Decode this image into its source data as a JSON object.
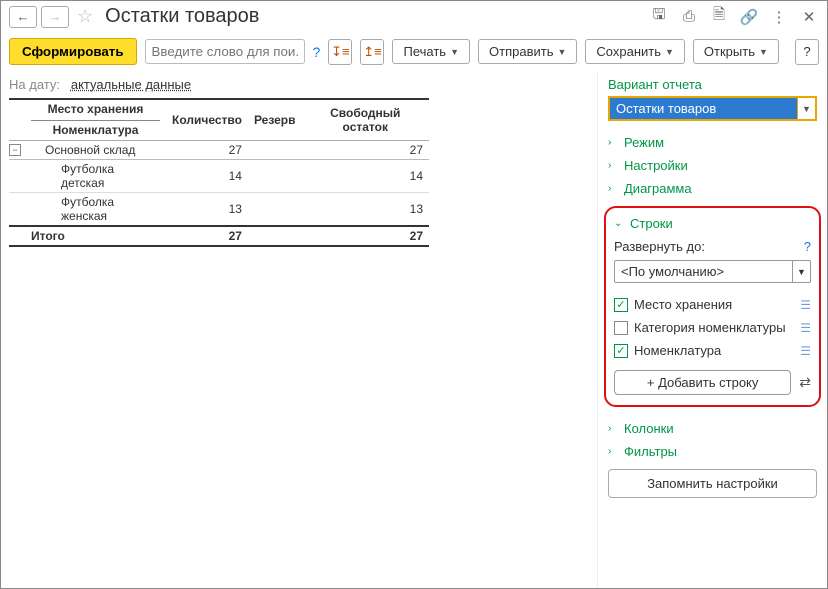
{
  "title": "Остатки товаров",
  "toolbar": {
    "generate": "Сформировать",
    "search_placeholder": "Введите слово для пои...",
    "print": "Печать",
    "send": "Отправить",
    "save": "Сохранить",
    "open": "Открыть"
  },
  "date": {
    "label": "На дату:",
    "value": "актуальные данные"
  },
  "table": {
    "header_storage": "Место хранения",
    "header_nomenclature": "Номенклатура",
    "header_qty": "Количество",
    "header_reserve": "Резерв",
    "header_free": "Свободный остаток",
    "rows": [
      {
        "type": "group",
        "name": "Основной склад",
        "qty": "27",
        "reserve": "",
        "free": "27"
      },
      {
        "type": "leaf",
        "name": "Футболка детская",
        "qty": "14",
        "reserve": "",
        "free": "14"
      },
      {
        "type": "leaf",
        "name": "Футболка женская",
        "qty": "13",
        "reserve": "",
        "free": "13"
      }
    ],
    "total_label": "Итого",
    "total_qty": "27",
    "total_reserve": "",
    "total_free": "27"
  },
  "right": {
    "variant_title": "Вариант отчета",
    "variant_value": "Остатки товаров",
    "acc_mode": "Режим",
    "acc_settings": "Настройки",
    "acc_chart": "Диаграмма",
    "acc_rows": "Строки",
    "expand_label": "Развернуть до:",
    "expand_value": "<По умолчанию>",
    "chk_storage": "Место хранения",
    "chk_category": "Категория номенклатуры",
    "chk_nomenclature": "Номенклатура",
    "add_row": "+ Добавить строку",
    "acc_columns": "Колонки",
    "acc_filters": "Фильтры",
    "remember": "Запомнить настройки"
  }
}
